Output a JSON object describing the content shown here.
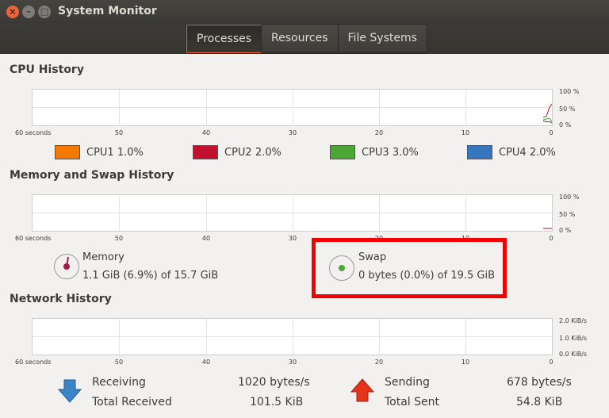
{
  "window": {
    "title": "System Monitor",
    "close_glyph": "×",
    "min_glyph": "–",
    "max_glyph": "□"
  },
  "tabs": [
    {
      "label": "Processes",
      "active": true
    },
    {
      "label": "Resources",
      "active": false
    },
    {
      "label": "File Systems",
      "active": false
    }
  ],
  "cpu": {
    "title": "CPU History",
    "y_labels": [
      "100 %",
      "50 %",
      "0 %"
    ],
    "x_labels": [
      "60 seconds",
      "50",
      "40",
      "30",
      "20",
      "10",
      "0"
    ],
    "legend": [
      {
        "label": "CPU1",
        "value": "1.0%",
        "color": "#f57900"
      },
      {
        "label": "CPU2",
        "value": "2.0%",
        "color": "#c4102f"
      },
      {
        "label": "CPU3",
        "value": "3.0%",
        "color": "#4ca633"
      },
      {
        "label": "CPU4",
        "value": "2.0%",
        "color": "#3576be"
      }
    ]
  },
  "memory": {
    "title": "Memory and Swap History",
    "y_labels": [
      "100 %",
      "50 %",
      "0 %"
    ],
    "x_labels": [
      "60 seconds",
      "50",
      "40",
      "30",
      "20",
      "10",
      "0"
    ],
    "memory_label": "Memory",
    "memory_value": "1.1 GiB (6.9%) of 15.7 GiB",
    "memory_color": "#a9164c",
    "swap_label": "Swap",
    "swap_value": "0 bytes (0.0%) of 19.5 GiB",
    "swap_color": "#4ca633"
  },
  "network": {
    "title": "Network History",
    "y_labels": [
      "2.0 KiB/s",
      "1.0 KiB/s",
      "0.0 KiB/s"
    ],
    "x_labels": [
      "60 seconds",
      "50",
      "40",
      "30",
      "20",
      "10",
      "0"
    ],
    "receiving_label": "Receiving",
    "receiving_value": "1020 bytes/s",
    "total_received_label": "Total Received",
    "total_received_value": "101.5 KiB",
    "sending_label": "Sending",
    "sending_value": "678 bytes/s",
    "total_sent_label": "Total Sent",
    "total_sent_value": "54.8 KiB",
    "receiving_icon": "down-arrow-icon",
    "sending_icon": "up-arrow-icon"
  }
}
